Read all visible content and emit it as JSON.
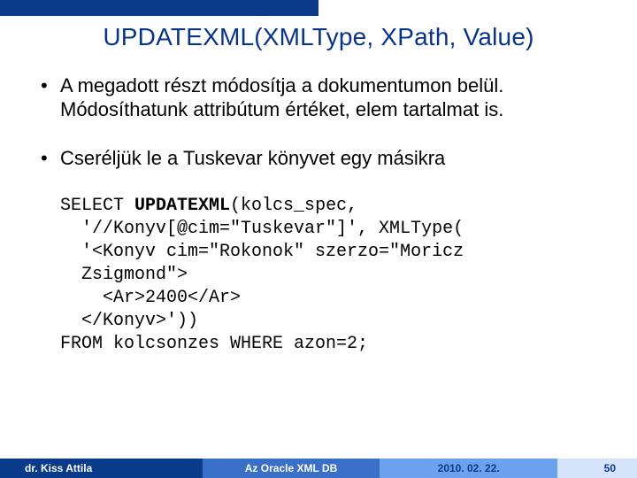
{
  "title": "UPDATEXML(XMLType, XPath, Value)",
  "bullets": {
    "b1": "A megadott részt módosítja a dokumentumon belül. Módosíthatunk attribútum értéket, elem tartalmat is.",
    "b2": "Cseréljük le a Tuskevar könyvet egy másikra"
  },
  "code": {
    "l1a": "SELECT ",
    "l1b": "UPDATEXML",
    "l1c": "(kolcs_spec,",
    "l2": "  '//Konyv[@cim=\"Tuskevar\"]', XMLType(",
    "l3": "  '<Konyv cim=\"Rokonok\" szerzo=\"Moricz",
    "l4": "  Zsigmond\">",
    "l5": "    <Ar>2400</Ar>",
    "l6": "  </Konyv>'))",
    "l7": "FROM kolcsonzes WHERE azon=2;"
  },
  "footer": {
    "author": "dr. Kiss Attila",
    "center": "Az Oracle XML DB",
    "date": "2010. 02. 22.",
    "page": "50"
  }
}
